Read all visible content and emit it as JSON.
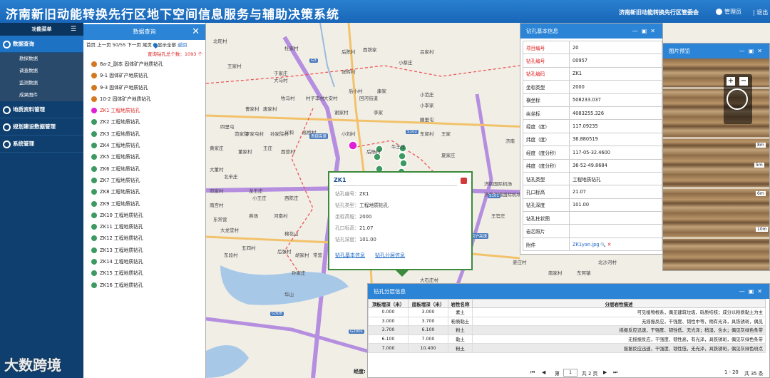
{
  "header": {
    "title": "济南新旧动能转换先行区地下空间信息服务与辅助决策系统",
    "org": "济南新旧动能转换先行区管委会",
    "user": "管理员",
    "exit": "| 退出"
  },
  "sidebar": {
    "title": "功能菜单",
    "query": "数据查询",
    "sub": [
      "勘探数据",
      "调查数据",
      "监测数据",
      "成果图件"
    ],
    "geo": "地质资料管理",
    "plan": "规划建设数据管理",
    "sys": "系统管理"
  },
  "query": {
    "title": "数据查询",
    "pager": "首页  上一页  50/55 下一页  尾页",
    "show_all": "显示全部",
    "back": "返回",
    "total": "查询钻孔总个数：1093 个",
    "items": [
      {
        "label": "8a-2_副本 固体矿产地质钻孔",
        "color": "#d4781f"
      },
      {
        "label": "9-1 固体矿产地质钻孔",
        "color": "#d4781f"
      },
      {
        "label": "9-3 固体矿产地质钻孔",
        "color": "#d4781f"
      },
      {
        "label": "10-2 固体矿产地质钻孔",
        "color": "#d4781f"
      },
      {
        "label": "ZK1 工程地质钻孔",
        "color": "#e11fd6"
      },
      {
        "label": "ZK2 工程地质钻孔",
        "color": "#3c9a60"
      },
      {
        "label": "ZK3 工程地质钻孔",
        "color": "#3c9a60"
      },
      {
        "label": "ZK4 工程地质钻孔",
        "color": "#3c9a60"
      },
      {
        "label": "ZK5 工程地质钻孔",
        "color": "#3c9a60"
      },
      {
        "label": "ZK6 工程地质钻孔",
        "color": "#3c9a60"
      },
      {
        "label": "ZK7 工程地质钻孔",
        "color": "#3c9a60"
      },
      {
        "label": "ZK8 工程地质钻孔",
        "color": "#3c9a60"
      },
      {
        "label": "ZK9 工程地质钻孔",
        "color": "#3c9a60"
      },
      {
        "label": "ZK10 工程地质钻孔",
        "color": "#3c9a60"
      },
      {
        "label": "ZK11 工程地质钻孔",
        "color": "#3c9a60"
      },
      {
        "label": "ZK12 工程地质钻孔",
        "color": "#3c9a60"
      },
      {
        "label": "ZK13 工程地质钻孔",
        "color": "#3c9a60"
      },
      {
        "label": "ZK14 工程地质钻孔",
        "color": "#3c9a60"
      },
      {
        "label": "ZK15 工程地质钻孔",
        "color": "#3c9a60"
      },
      {
        "label": "ZK16 工程地质钻孔",
        "color": "#3c9a60"
      }
    ]
  },
  "map": {
    "labels": [
      "北旺村",
      "杜家村",
      "后陈村",
      "西铁家",
      "吕家村",
      "王家村",
      "小蔡庄",
      "于家庄",
      "大马村",
      "康家",
      "后小村",
      "小范庄",
      "张砖村",
      "曹家村",
      "牧马村",
      "村子李村",
      "大安村",
      "回河街道",
      "小李家",
      "唐家村",
      "谢家村",
      "李家",
      "圈里屯",
      "四里屯",
      "范家院",
      "孙家院村",
      "罗家屯村",
      "义和",
      "高桥村",
      "小刘村",
      "东郭村",
      "王家",
      "黄家庄",
      "王庄",
      "后杨村",
      "牛王庄",
      "董家村",
      "西营村",
      "夏家庄",
      "大董村",
      "北辛庄",
      "邓家村",
      "龙王庄",
      "小王庄",
      "西陈庄",
      "东康宁",
      "南宫村",
      "东常营",
      "大龙堂村",
      "燕场",
      "河南村",
      "大段庄",
      "棉花山",
      "东段村",
      "五四村",
      "后张村",
      "胡家村",
      "常营",
      "大王村",
      "孙家庄",
      "华山",
      "济南国际机场",
      "济南遥墙国际机场",
      "王官庄",
      "李家庄",
      "沙王村",
      "大辛庄",
      "王舍村",
      "河阳店村",
      "南家村",
      "东阿镇",
      "济南",
      "姜庄村",
      "北沙河村",
      "雀营村",
      "大牟庄村",
      "郭家庄",
      "东李村",
      "东庄村",
      "大石庄村"
    ],
    "roads": [
      "G3",
      "G20",
      "G104",
      "G308",
      "G2001",
      "G35",
      "S102",
      "S101",
      "青银高速",
      "京沪高速"
    ],
    "coord": "经度:"
  },
  "popup": {
    "title": "ZK1",
    "rows": [
      [
        "钻孔编号：",
        "ZK1"
      ],
      [
        "钻孔类型：",
        "工程地质钻孔"
      ],
      [
        "坐标高程：",
        "2000"
      ],
      [
        "孔口标高：",
        "21.07"
      ],
      [
        "钻孔深度：",
        "101.00"
      ]
    ],
    "link1": "钻孔基本信息",
    "link2": "钻孔分层信息"
  },
  "info": {
    "title": "钻孔基本信息",
    "rows": [
      [
        "项目编号",
        "20",
        true
      ],
      [
        "钻孔编号",
        "00957",
        true
      ],
      [
        "钻孔编码",
        "ZK1",
        true
      ],
      [
        "坐标类型",
        "2000",
        false
      ],
      [
        "横坐标",
        "508233.037",
        false
      ],
      [
        "纵坐标",
        "4083255.326",
        false
      ],
      [
        "经度（度）",
        "117.09235",
        false
      ],
      [
        "纬度（度）",
        "36.880519",
        false
      ],
      [
        "经度（度分秒）",
        "117-05-32.4600",
        false
      ],
      [
        "纬度（度分秒）",
        "36-52-49.8684",
        false
      ],
      [
        "钻孔类型",
        "工程地质钻孔",
        false
      ],
      [
        "孔口标高",
        "21.07",
        false
      ],
      [
        "钻孔深度",
        "101.00",
        false
      ],
      [
        "钻孔柱状图",
        "",
        false
      ],
      [
        "岩芯照片",
        "",
        false
      ],
      [
        "附件",
        "ZK1yan.jpg",
        false
      ]
    ]
  },
  "image": {
    "title": "图片预览",
    "scales": [
      "8m",
      "5m",
      "6m",
      "10m"
    ]
  },
  "layers": {
    "title": "钻孔分层信息",
    "cols": [
      "顶板埋深（米）",
      "底板埋深（米）",
      "岩性名称",
      "分层岩性描述"
    ],
    "rows": [
      [
        "0.000",
        "3.000",
        "素土",
        "可见植物根系，偶见建筑垃圾、砾质结核；成分以粉质黏土为主"
      ],
      [
        "3.000",
        "3.700",
        "粉质黏土",
        "无摇振反应，干强度、韧性中等，稍有光泽，具铁锈斑，偶见"
      ],
      [
        "3.700",
        "6.100",
        "粉土",
        "摇振反应迅速，干强度、韧性低、无光泽；稍湿，含水；偶见灰绿色条带"
      ],
      [
        "6.100",
        "7.000",
        "黏土",
        "无摇振反应，干强度、韧性高，有光泽，具铁锈斑，偶见灰绿色条带"
      ],
      [
        "7.000",
        "10.400",
        "粉土",
        "摇振反应迅速，干强度、韧性低，无光泽，具铁锈斑，偶见灰绿色斑点"
      ]
    ],
    "footer": {
      "p1": "第",
      "p2": "共 2 页",
      "range": "1 - 20",
      "count": "共 35 条"
    }
  },
  "watermark": "大数跨境"
}
